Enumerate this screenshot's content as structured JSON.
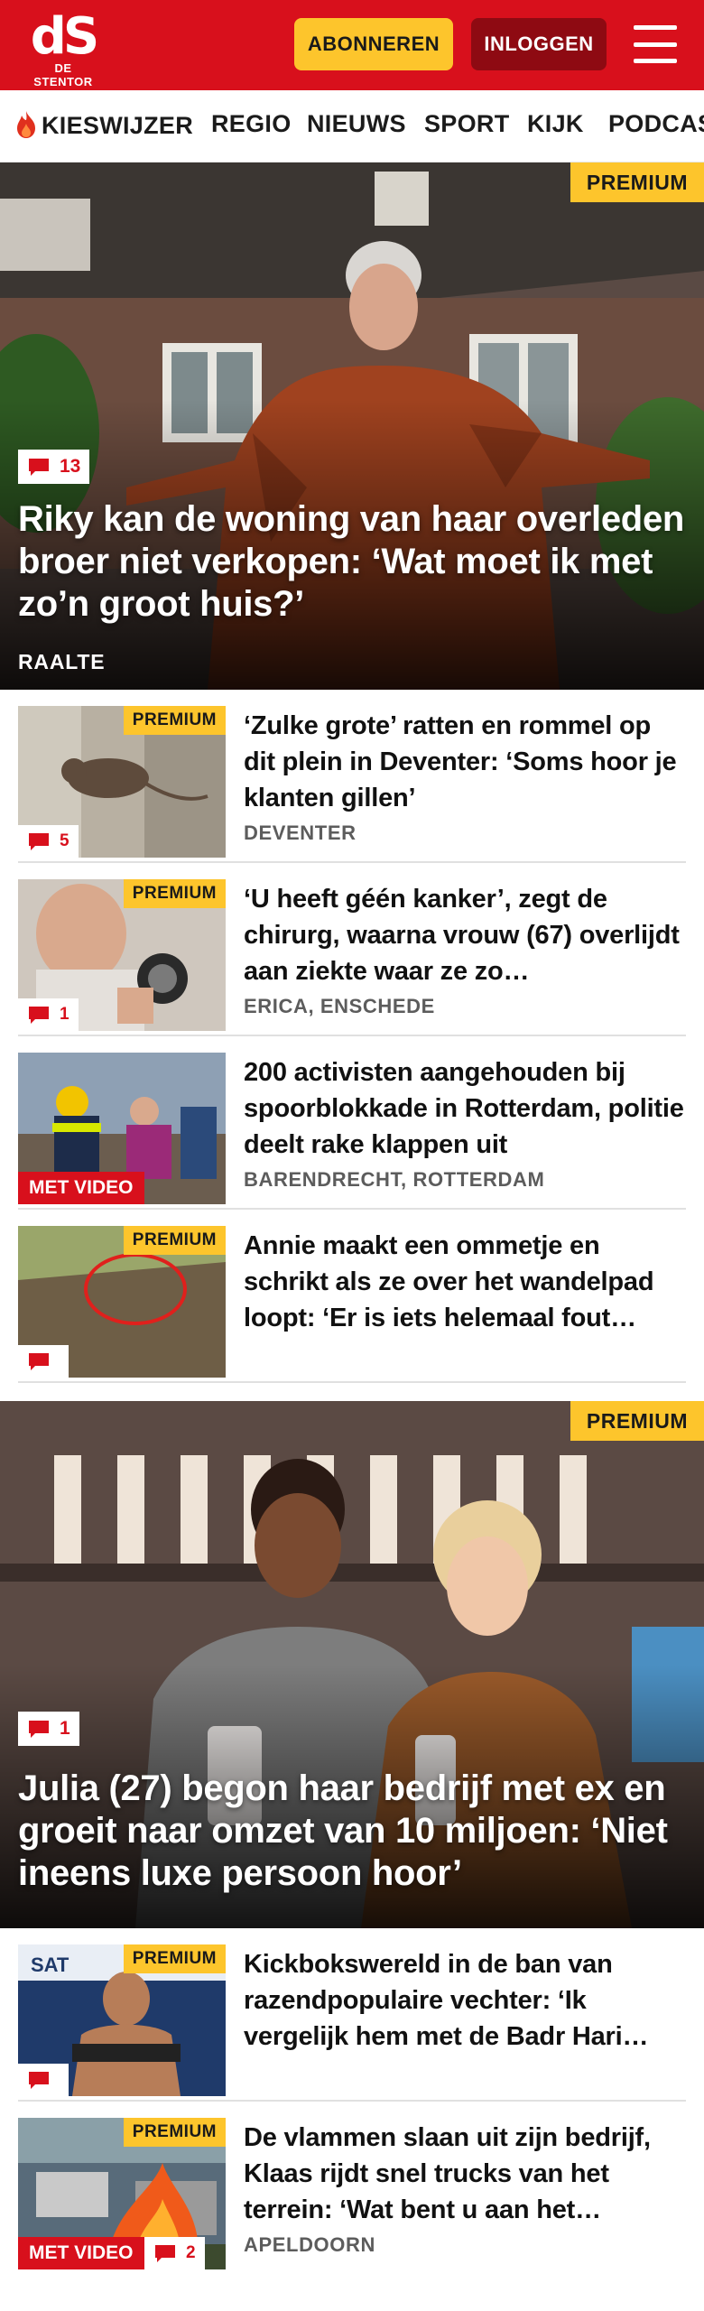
{
  "header": {
    "logo_text": "dS",
    "logo_subtext": "DE STENTOR",
    "subscribe_label": "ABONNEREN",
    "login_label": "INLOGGEN",
    "brand_color": "#d8101c",
    "accent_color": "#fdc52c"
  },
  "nav": {
    "items": [
      {
        "label": "KIESWIJZER",
        "icon": "flame-icon"
      },
      {
        "label": "REGIO"
      },
      {
        "label": "NIEUWS"
      },
      {
        "label": "SPORT"
      },
      {
        "label": "KIJK"
      },
      {
        "label": "PODCAS"
      }
    ]
  },
  "hero1": {
    "badge": "PREMIUM",
    "comments": "13",
    "title": "Riky kan de woning van haar overleden broer niet verkopen: ‘Wat moet ik met zo’n groot huis?’",
    "location": "RAALTE"
  },
  "list1": [
    {
      "premium": "PREMIUM",
      "comments": "5",
      "title": "‘Zulke grote’ ratten en rommel op dit plein in Deventer: ‘Soms hoor je klanten gillen’",
      "location": "DEVENTER"
    },
    {
      "premium": "PREMIUM",
      "comments": "1",
      "title": "‘U heeft géén kanker’, zegt de chirurg, waarna vrouw (67) overlijdt aan ziekte waar ze zo…",
      "location": "ERICA, ENSCHEDE"
    },
    {
      "video": "MET VIDEO",
      "title": "200 activisten aangehouden bij spoorblokkade in Rotterdam, politie deelt rake klappen uit",
      "location": "BARENDRECHT, ROTTERDAM"
    },
    {
      "premium": "PREMIUM",
      "comments": "",
      "title": "Annie maakt een ommetje en schrikt als ze over het wandelpad loopt: ‘Er is iets helemaal fout…",
      "location": ""
    }
  ],
  "hero2": {
    "badge": "PREMIUM",
    "comments": "1",
    "title": "Julia (27) begon haar bedrijf met ex en groeit naar omzet van 10 miljoen: ‘Niet ineens luxe persoon hoor’"
  },
  "list2": [
    {
      "premium": "PREMIUM",
      "comments": "",
      "title": "Kickbokswereld in de ban van razendpopulaire vechter: ‘Ik vergelijk hem met de Badr Hari…",
      "location": ""
    },
    {
      "premium": "PREMIUM",
      "video": "MET VIDEO",
      "comments": "2",
      "title": "De vlammen slaan uit zijn bedrijf, Klaas rijdt snel trucks van het terrein: ‘Wat bent u aan het…",
      "location": "APELDOORN"
    }
  ]
}
